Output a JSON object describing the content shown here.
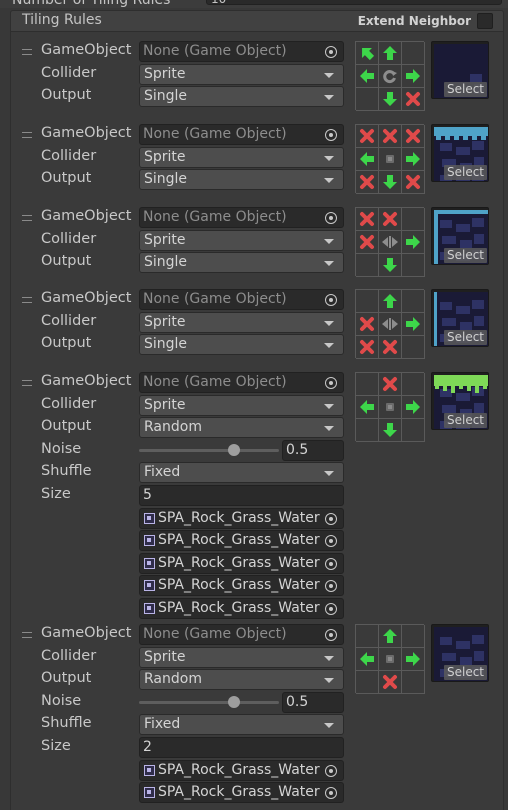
{
  "top_partial": {
    "label": "Number of Tiling Rules",
    "value": "10"
  },
  "header": {
    "title": "Tiling Rules",
    "extend_neighbor_label": "Extend Neighbor",
    "extend_neighbor_checked": false
  },
  "labels": {
    "gameobject": "GameObject",
    "collider": "Collider",
    "output": "Output",
    "noise": "Noise",
    "shuffle": "Shuffle",
    "size": "Size",
    "select": "Select"
  },
  "rules": [
    {
      "gameobject": "None (Game Object)",
      "collider": "Sprite",
      "output": "Single",
      "neighbors": [
        "this-up-left",
        "this-up",
        "",
        "this-left",
        "rotate",
        "this-right",
        "",
        "this-down",
        "not-this"
      ],
      "preview": "rock-corner"
    },
    {
      "gameobject": "None (Game Object)",
      "collider": "Sprite",
      "output": "Single",
      "neighbors": [
        "not-this",
        "not-this",
        "not-this",
        "this-left",
        "center",
        "this-right",
        "not-this",
        "this-down",
        "not-this"
      ],
      "preview": "rock-water-edge"
    },
    {
      "gameobject": "None (Game Object)",
      "collider": "Sprite",
      "output": "Single",
      "neighbors": [
        "not-this",
        "not-this",
        "",
        "not-this",
        "mirror-x",
        "this-right",
        "",
        "this-down",
        ""
      ],
      "preview": "rock-water-frame"
    },
    {
      "gameobject": "None (Game Object)",
      "collider": "Sprite",
      "output": "Single",
      "neighbors": [
        "",
        "this-up",
        "",
        "not-this",
        "mirror-x",
        "this-right",
        "not-this",
        "not-this",
        ""
      ],
      "preview": "rock-right-edge"
    },
    {
      "gameobject": "None (Game Object)",
      "collider": "Sprite",
      "output": "Random",
      "noise": "0.5",
      "noise_value": 0.5,
      "shuffle": "Fixed",
      "size": "5",
      "sprites": [
        "SPA_Rock_Grass_Water",
        "SPA_Rock_Grass_Water",
        "SPA_Rock_Grass_Water",
        "SPA_Rock_Grass_Water",
        "SPA_Rock_Grass_Water"
      ],
      "neighbors": [
        "",
        "not-this",
        "",
        "this-left",
        "center",
        "this-right",
        "",
        "this-down",
        ""
      ],
      "preview": "rock-grass-top"
    },
    {
      "gameobject": "None (Game Object)",
      "collider": "Sprite",
      "output": "Random",
      "noise": "0.5",
      "noise_value": 0.5,
      "shuffle": "Fixed",
      "size": "2",
      "sprites": [
        "SPA_Rock_Grass_Water",
        "SPA_Rock_Grass_Water"
      ],
      "neighbors": [
        "",
        "this-up",
        "",
        "this-left",
        "center",
        "this-right",
        "",
        "not-this",
        ""
      ],
      "preview": "rock-fill"
    }
  ],
  "colors": {
    "green_arrow": "#3dd64a",
    "red_x": "#e04a4a",
    "tile_dark": "#1a1a36",
    "tile_stone": "#2e3264",
    "grass": "#7ed957",
    "water_edge": "#4fa3c8"
  }
}
